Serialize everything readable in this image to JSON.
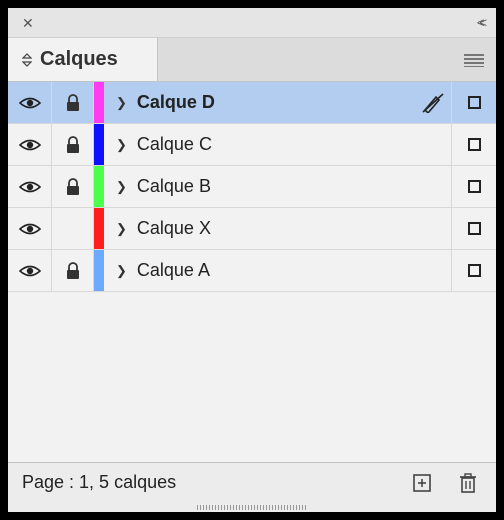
{
  "panel": {
    "title": "Calques"
  },
  "layers": [
    {
      "name": "Calque D",
      "color": "#ff3cf0",
      "locked": true,
      "visible": true,
      "selected": true,
      "penDisabled": true
    },
    {
      "name": "Calque C",
      "color": "#1010ff",
      "locked": true,
      "visible": true,
      "selected": false,
      "penDisabled": false
    },
    {
      "name": "Calque B",
      "color": "#4cff4c",
      "locked": true,
      "visible": true,
      "selected": false,
      "penDisabled": false
    },
    {
      "name": "Calque X",
      "color": "#ff1e1e",
      "locked": false,
      "visible": true,
      "selected": false,
      "penDisabled": false
    },
    {
      "name": "Calque A",
      "color": "#6ea8ff",
      "locked": true,
      "visible": true,
      "selected": false,
      "penDisabled": false
    }
  ],
  "footer": {
    "status": "Page : 1, 5 calques"
  }
}
